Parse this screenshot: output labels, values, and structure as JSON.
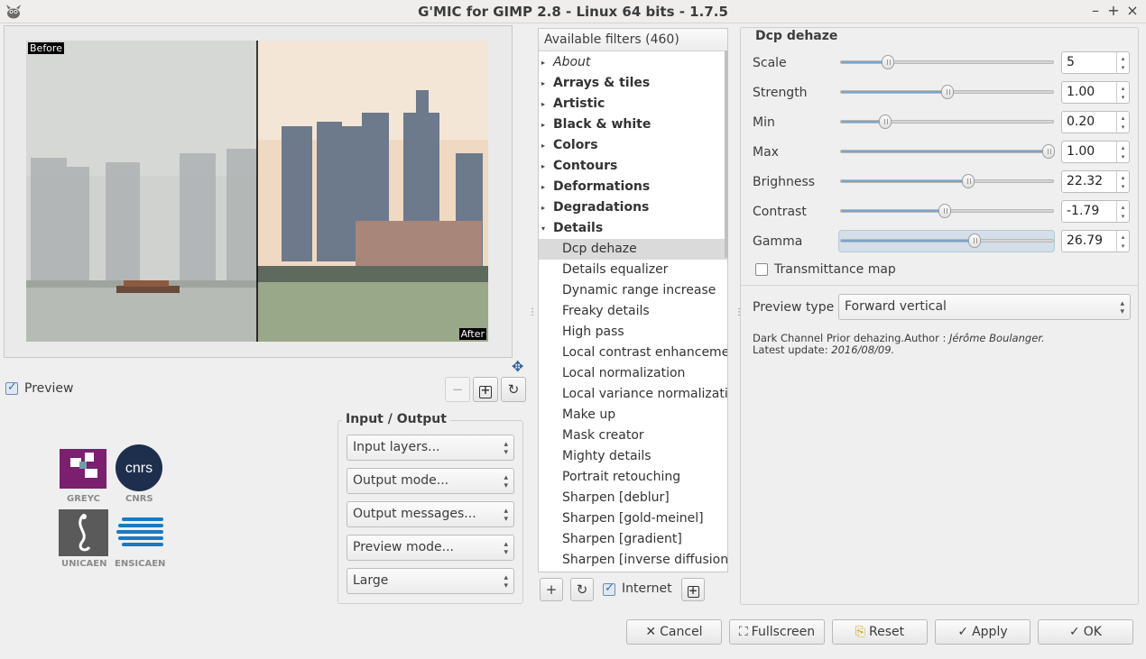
{
  "window": {
    "title": "G'MIC for GIMP 2.8 - Linux 64 bits - 1.7.5",
    "controls": [
      "–",
      "+",
      "×"
    ]
  },
  "preview": {
    "before_tag": "Before",
    "after_tag": "After",
    "checkbox_label": "Preview",
    "checked": true,
    "zoom_out": "−",
    "zoom_fit": "+",
    "refresh": "↻"
  },
  "logos": [
    "GREYC",
    "CNRS",
    "UNICAEN",
    "ENSICAEN"
  ],
  "io": {
    "title": "Input / Output",
    "combos": [
      "Input layers...",
      "Output mode...",
      "Output messages...",
      "Preview mode...",
      "Large"
    ]
  },
  "filters": {
    "header": "Available filters (460)",
    "items": [
      {
        "label": "About",
        "type": "category",
        "style": "italic"
      },
      {
        "label": "Arrays & tiles",
        "type": "category",
        "style": "bold"
      },
      {
        "label": "Artistic",
        "type": "category",
        "style": "bold"
      },
      {
        "label": "Black & white",
        "type": "category",
        "style": "bold"
      },
      {
        "label": "Colors",
        "type": "category",
        "style": "bold"
      },
      {
        "label": "Contours",
        "type": "category",
        "style": "bold"
      },
      {
        "label": "Deformations",
        "type": "category",
        "style": "bold"
      },
      {
        "label": "Degradations",
        "type": "category",
        "style": "bold"
      },
      {
        "label": "Details",
        "type": "category-open",
        "style": "bold"
      },
      {
        "label": "Dcp dehaze",
        "type": "child",
        "selected": true
      },
      {
        "label": "Details equalizer",
        "type": "child"
      },
      {
        "label": "Dynamic range increase",
        "type": "child"
      },
      {
        "label": "Freaky details",
        "type": "child"
      },
      {
        "label": "High pass",
        "type": "child"
      },
      {
        "label": "Local contrast enhancement",
        "type": "child"
      },
      {
        "label": "Local normalization",
        "type": "child"
      },
      {
        "label": "Local variance normalization",
        "type": "child"
      },
      {
        "label": "Make up",
        "type": "child"
      },
      {
        "label": "Mask creator",
        "type": "child"
      },
      {
        "label": "Mighty details",
        "type": "child"
      },
      {
        "label": "Portrait retouching",
        "type": "child"
      },
      {
        "label": "Sharpen [deblur]",
        "type": "child"
      },
      {
        "label": "Sharpen [gold-meinel]",
        "type": "child"
      },
      {
        "label": "Sharpen [gradient]",
        "type": "child"
      },
      {
        "label": "Sharpen [inverse diffusion]",
        "type": "child"
      }
    ],
    "add_btn": "+",
    "refresh_btn": "↻",
    "internet_label": "Internet",
    "internet_checked": true,
    "expand_btn": "+"
  },
  "filter_params": {
    "title": "Dcp dehaze",
    "params": [
      {
        "name": "Scale",
        "value": "5",
        "fraction": 0.22
      },
      {
        "name": "Strength",
        "value": "1.00",
        "fraction": 0.5
      },
      {
        "name": "Min",
        "value": "0.20",
        "fraction": 0.21
      },
      {
        "name": "Max",
        "value": "1.00",
        "fraction": 0.98
      },
      {
        "name": "Brighness",
        "value": "22.32",
        "fraction": 0.6
      },
      {
        "name": "Contrast",
        "value": "-1.79",
        "fraction": 0.49
      },
      {
        "name": "Gamma",
        "value": "26.79",
        "fraction": 0.63
      }
    ],
    "transmittance_label": "Transmittance map",
    "transmittance_checked": false,
    "preview_type_label": "Preview type",
    "preview_type_value": "Forward vertical",
    "description_line1_prefix": "Dark Channel Prior dehazing.Author : ",
    "description_author": "Jérôme Boulanger.",
    "description_line2_prefix": "Latest update: ",
    "description_date": "2016/08/09."
  },
  "buttons": {
    "cancel": "Cancel",
    "fullscreen": "Fullscreen",
    "reset": "Reset",
    "apply": "Apply",
    "ok": "OK"
  },
  "colors": {
    "accent": "#7aa4cc",
    "selection": "#dadada",
    "window_bg": "#efefef"
  }
}
